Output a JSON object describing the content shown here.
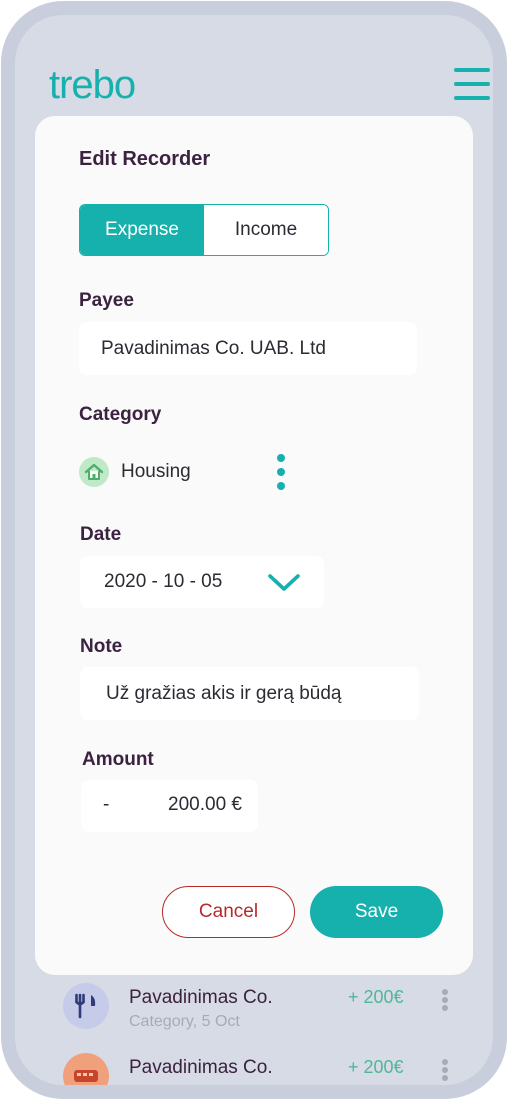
{
  "app": {
    "logo": "trebo"
  },
  "form": {
    "title": "Edit Recorder",
    "toggle": {
      "expense": "Expense",
      "income": "Income",
      "selected": "Expense"
    },
    "payee": {
      "label": "Payee",
      "value": "Pavadinimas Co. UAB. Ltd"
    },
    "category": {
      "label": "Category",
      "value": "Housing",
      "icon": "house-icon"
    },
    "date": {
      "label": "Date",
      "value": "2020 - 10 - 05"
    },
    "note": {
      "label": "Note",
      "value": "Už gražias akis ir gerą būdą"
    },
    "amount": {
      "label": "Amount",
      "sign": "-",
      "value": "200.00 €"
    },
    "cancel_label": "Cancel",
    "save_label": "Save"
  },
  "transactions": [
    {
      "name": "Pavadinimas Co.",
      "sub": "Category, 5 Oct",
      "amount": "+ 200€",
      "icon": "fork-knife-icon"
    },
    {
      "name": "Pavadinimas Co.",
      "sub": "",
      "amount": "+ 200€",
      "icon": "bus-icon"
    }
  ],
  "colors": {
    "accent": "#17b1ad",
    "danger": "#b72a2a",
    "positive": "#51b59a"
  }
}
